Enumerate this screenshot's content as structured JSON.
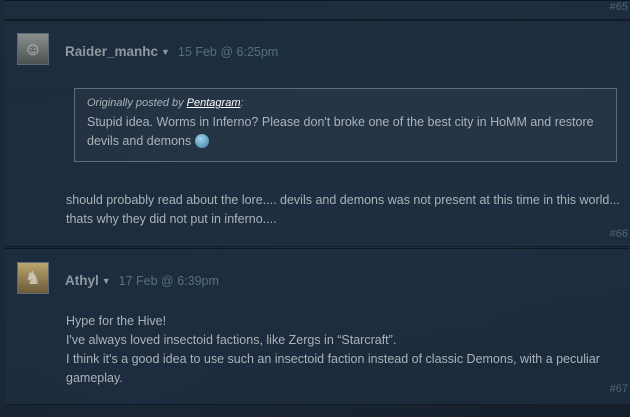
{
  "colors": {
    "background": "#1b2838",
    "author": "#8f98a0",
    "timestamp": "#56707f",
    "text": "#acb2b8",
    "number": "#4f6479"
  },
  "comments": [
    {
      "number": "#65"
    },
    {
      "author": "Raider_manhc",
      "timestamp": "15 Feb @ 6:25pm",
      "avatar": "avatar-image",
      "quote": {
        "prefix": "Originally posted by",
        "quoted_author": "Pentagram",
        "suffix": ":",
        "text": "Stupid idea. Worms in Inferno? Please don't broke one of the best city in HoMM and restore devils and demons"
      },
      "body_lines": [
        "should probably read about the lore.... devils and demons was not present at this time in this world... thats why they did not put in inferno...."
      ],
      "number": "#66"
    },
    {
      "author": "Athyl",
      "timestamp": "17 Feb @ 6:39pm",
      "avatar": "avatar-image",
      "body_lines": [
        "Hype for the Hive!",
        "I've always loved insectoid factions, like Zergs in “Starcraft”.",
        "I think it's a good idea to use such an insectoid faction instead of classic Demons, with a peculiar gameplay."
      ],
      "number": "#67"
    }
  ]
}
